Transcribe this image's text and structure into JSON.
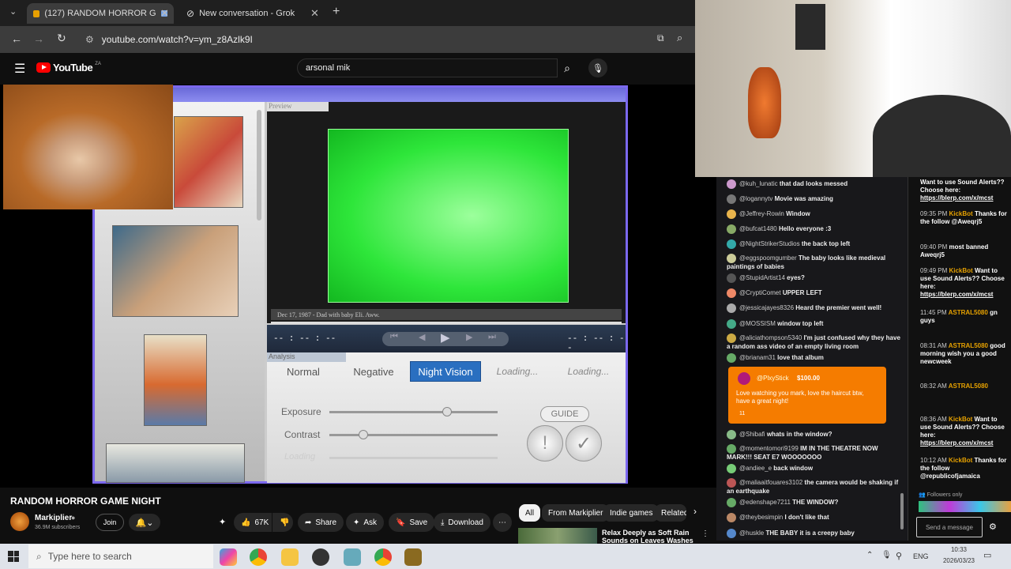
{
  "browser": {
    "tabs": [
      {
        "label": "(127) RANDOM HORROR G"
      },
      {
        "label": "New conversation - Grok"
      }
    ],
    "url": "youtube.com/watch?v=ym_z8Azlk9I"
  },
  "youtube": {
    "logo": "YouTube",
    "logo_region": "ZA",
    "search_value": "arsonal mik"
  },
  "game": {
    "preview_label": "Preview",
    "caption": "Dec 17, 1987 - Dad with baby Eli. Aww.",
    "time_left": "-- : -- : --",
    "time_right": "-- : -- : --",
    "analysis_label": "Analysis",
    "buttons": [
      "Normal",
      "Negative",
      "Night Vision",
      "Loading...",
      "Loading..."
    ],
    "active_button": "Night Vision",
    "sliders": [
      {
        "label": "Exposure",
        "value": 0.7
      },
      {
        "label": "Contrast",
        "value": 0.2
      },
      {
        "label": "Loading",
        "value": 0.5
      }
    ],
    "guide": "GUIDE"
  },
  "video": {
    "title": "RANDOM HORROR GAME NIGHT",
    "channel": "Markiplier",
    "subscribers": "36.9M subscribers",
    "join": "Join",
    "likes": "67K",
    "share": "Share",
    "ask": "Ask",
    "save": "Save",
    "download": "Download"
  },
  "filter_chips": [
    "All",
    "From Markiplier",
    "Indie games",
    "Related"
  ],
  "recommended": {
    "title": "Relax Deeply as Soft Rain Sounds on Leaves Washes"
  },
  "chat": [
    {
      "user": "@kuh_lunatic",
      "text": "that dad looks messed",
      "color": "#c9c"
    },
    {
      "user": "@logannytv",
      "text": "Movie was amazing",
      "color": "#777"
    },
    {
      "user": "@Jeffrey-Rowin",
      "text": "Window",
      "color": "#e9b44c"
    },
    {
      "user": "@bufcat1480",
      "text": "Hello everyone :3",
      "color": "#8a6"
    },
    {
      "user": "@NightStrikerStudios",
      "text": "the back top left",
      "color": "#3aa"
    },
    {
      "user": "@eggspoomgumber",
      "text": "The baby looks like medieval paintings of babies",
      "color": "#cc9"
    },
    {
      "user": "@StupidArtist14",
      "text": "eyes?",
      "color": "#555"
    },
    {
      "user": "@CryptiComet",
      "text": "UPPER LEFT",
      "color": "#e86"
    },
    {
      "user": "@jessicajayes8326",
      "text": "Heard the premier went well!",
      "color": "#aaa"
    },
    {
      "user": "@MOSSISM",
      "text": "window top left",
      "color": "#4a8"
    },
    {
      "user": "@aliciathompson5340",
      "text": "I'm just confused why they have a random ass video of an empty living room",
      "color": "#ca4"
    },
    {
      "user": "@brianam31",
      "text": "love that album",
      "color": "#6a6"
    }
  ],
  "superchat": {
    "user": "@PlxyStick",
    "amount": "$100.00",
    "text": "Love watching you mark, love the haircut btw, have a great night!",
    "count": "11"
  },
  "chat_after": [
    {
      "user": "@Shibafi",
      "text": "whats in the window?",
      "color": "#8b8"
    },
    {
      "user": "@momentomori9199",
      "text": "IM IN THE THEATRE NOW MARK!!! SEAT E7 WOOOOOOO",
      "color": "#6a6"
    },
    {
      "user": "@andiee_e",
      "text": "back window",
      "color": "#7c7"
    },
    {
      "user": "@maliaaitfouares3102",
      "text": "the camera would be shaking if an earthquake",
      "color": "#b55"
    },
    {
      "user": "@edenshape7211",
      "text": "THE WINDOW?",
      "color": "#6a6"
    },
    {
      "user": "@theybesimpin",
      "text": "I don't like that",
      "color": "#b86"
    },
    {
      "user": "@huskle",
      "text": "THE BABY it is a creepy baby",
      "color": "#58c"
    }
  ],
  "chat2": {
    "top": "Want to use Sound Alerts?? Choose here:",
    "link": "https://blerp.com/x/mcst",
    "entries": [
      {
        "time": "09:35 PM",
        "user": "KickBot",
        "text": "Thanks for the follow @Aweqrj5"
      },
      {
        "time": "09:40 PM",
        "user": "",
        "text": "most banned Aweqrj5"
      },
      {
        "time": "09:49 PM",
        "user": "KickBot",
        "text": "Want to use Sound Alerts?? Choose here:",
        "link": "https://blerp.com/x/mcst"
      },
      {
        "time": "11:45 PM",
        "user": "ASTRAL5080",
        "text": "gn guys"
      },
      {
        "time": "08:31 AM",
        "user": "ASTRAL5080",
        "text": "good morning wish you a good newcweek"
      },
      {
        "time": "08:32 AM",
        "user": "ASTRAL5080",
        "text": ""
      },
      {
        "time": "08:36 AM",
        "user": "KickBot",
        "text": "Want to use Sound Alerts?? Choose here:",
        "link": "https://blerp.com/x/mcst"
      },
      {
        "time": "10:12 AM",
        "user": "KickBot",
        "text": "Thanks for the follow @republicofjamaica"
      }
    ],
    "followers_only": "Followers only",
    "send_placeholder": "Send a message"
  },
  "taskbar": {
    "search": "Type here to search",
    "lang": "ENG",
    "time": "10:33",
    "date": "2026/03/23"
  }
}
